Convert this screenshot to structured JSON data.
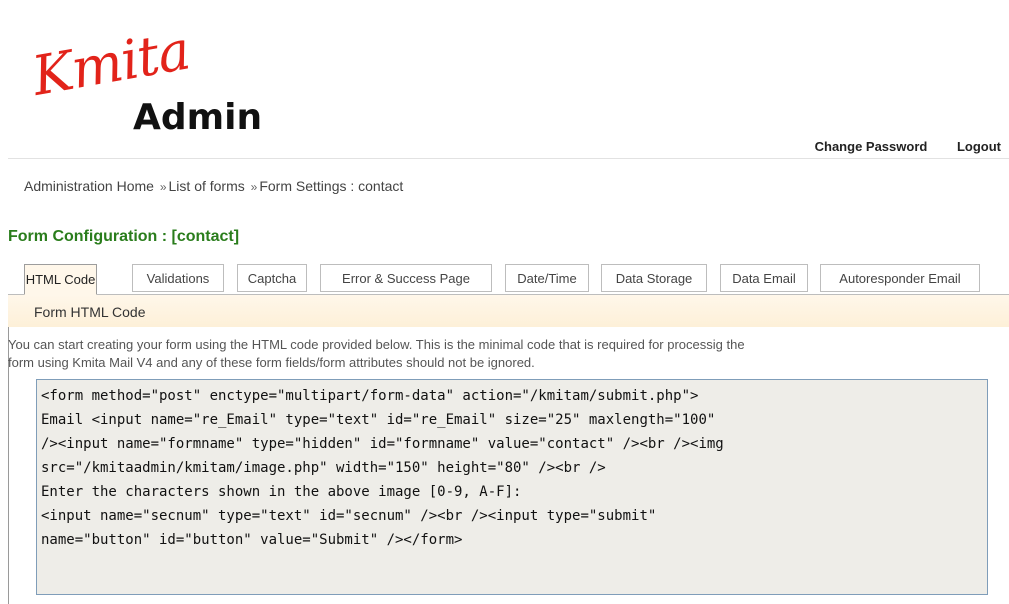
{
  "header": {
    "logo_script": "Kmita",
    "logo_word": "Admin",
    "change_password": "Change Password",
    "logout": "Logout"
  },
  "breadcrumb": {
    "home": "Administration Home",
    "sep": "»",
    "list": "List of forms",
    "current": "Form Settings : contact"
  },
  "page_title": "Form Configuration : [contact]",
  "tabs": [
    {
      "label": "HTML Code"
    },
    {
      "label": "Validations"
    },
    {
      "label": "Captcha"
    },
    {
      "label": "Error & Success Page"
    },
    {
      "label": "Date/Time"
    },
    {
      "label": "Data Storage"
    },
    {
      "label": "Data Email"
    },
    {
      "label": "Autoresponder Email"
    }
  ],
  "section_title": "Form HTML Code",
  "intro": [
    "You can start creating your form using the HTML code provided below. This is the minimal code that is required for processig the",
    "form using Kmita Mail V4 and any of these form fields/form attributes should not be ignored."
  ],
  "code_lines": [
    "<form method=\"post\" enctype=\"multipart/form-data\" action=\"/kmitam/submit.php\">",
    "Email <input name=\"re_Email\" type=\"text\" id=\"re_Email\" size=\"25\" maxlength=\"100\"",
    "/><input name=\"formname\" type=\"hidden\" id=\"formname\" value=\"contact\" /><br /><img",
    "src=\"/kmitaadmin/kmitam/image.php\" width=\"150\" height=\"80\" /><br />",
    "Enter the characters shown in the above image [0-9, A-F]:",
    "<input name=\"secnum\" type=\"text\" id=\"secnum\" /><br /><input type=\"submit\"",
    "name=\"button\" id=\"button\" value=\"Submit\" /></form>"
  ]
}
